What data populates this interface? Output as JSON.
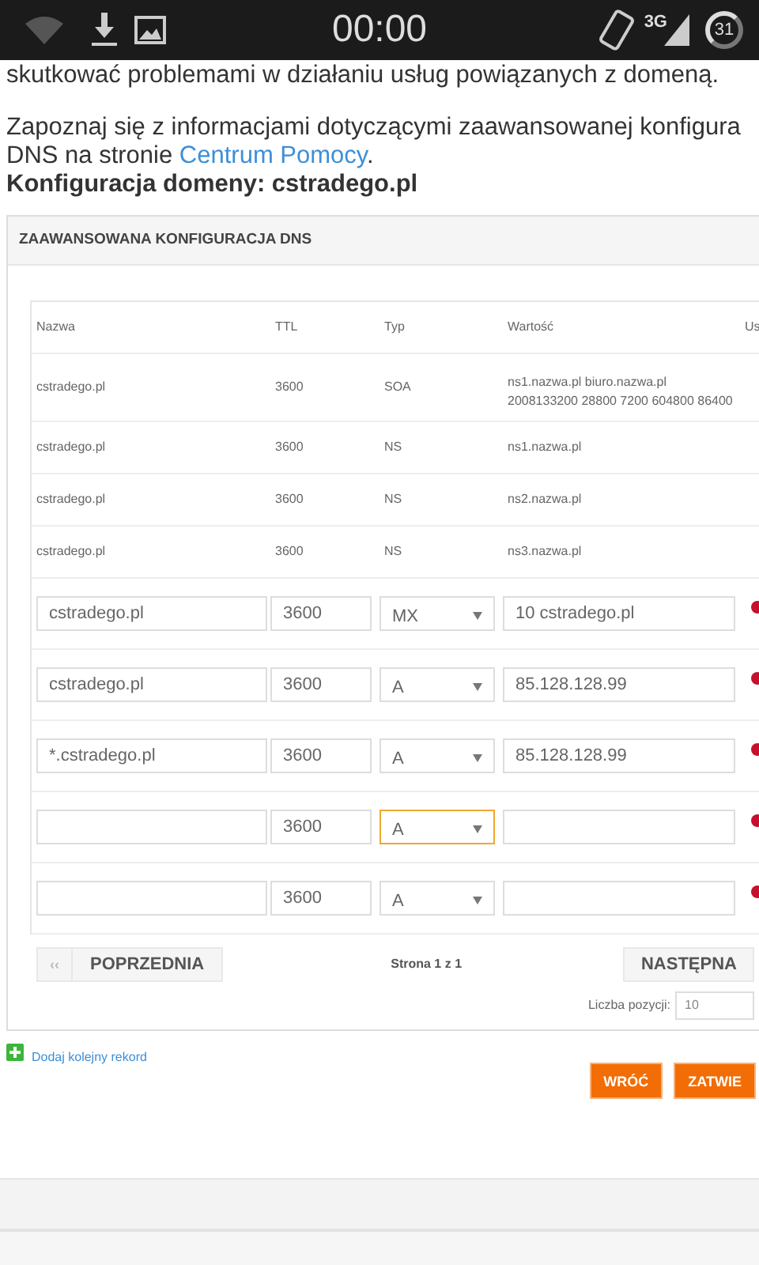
{
  "status_bar": {
    "time": "00:00",
    "network": "3G",
    "battery": "31"
  },
  "intro_cut": "skutkować problemami w działaniu usług powiązanych z domeną.",
  "info": {
    "lines": [
      "Zapoznaj się z informacjami dotyczącymi zaawansowanej konfigura",
      "DNS na stronie "
    ],
    "link": "Centrum Pomocy",
    "after": "."
  },
  "heading": "Konfiguracja domeny: cstradego.pl",
  "panel": {
    "title": "ZAAWANSOWANA KONFIGURACJA DNS",
    "columns": [
      "Nazwa",
      "TTL",
      "Typ",
      "Wartość",
      "Us"
    ],
    "rows": [
      {
        "name": "cstradego.pl",
        "ttl": "3600",
        "type": "SOA",
        "value": "ns1.nazwa.pl biuro.nazwa.pl 2008133200 28800 7200 604800 86400"
      },
      {
        "name": "cstradego.pl",
        "ttl": "3600",
        "type": "NS",
        "value": "ns1.nazwa.pl"
      },
      {
        "name": "cstradego.pl",
        "ttl": "3600",
        "type": "NS",
        "value": "ns2.nazwa.pl"
      },
      {
        "name": "cstradego.pl",
        "ttl": "3600",
        "type": "NS",
        "value": "ns3.nazwa.pl"
      }
    ],
    "edit_rows": [
      {
        "name": "cstradego.pl",
        "ttl": "3600",
        "type": "MX",
        "value": "10 cstradego.pl",
        "type_focused": false
      },
      {
        "name": "cstradego.pl",
        "ttl": "3600",
        "type": "A",
        "value": "85.128.128.99",
        "type_focused": false
      },
      {
        "name": "*.cstradego.pl",
        "ttl": "3600",
        "type": "A",
        "value": "85.128.128.99",
        "type_focused": false
      },
      {
        "ttl": "3600",
        "type": "A",
        "type_focused": true
      },
      {
        "ttl": "3600",
        "type": "A",
        "type_focused": false
      }
    ],
    "pagination": {
      "prev_arrow": "‹‹",
      "prev": "POPRZEDNIA",
      "page": "Strona 1 z 1",
      "next": "NASTĘPNA"
    },
    "page_size": {
      "label": "Liczba pozycji:",
      "value": "10"
    }
  },
  "add_link": "Dodaj kolejny rekord",
  "buttons": [
    "WRÓĆ",
    "ZATWIE"
  ]
}
